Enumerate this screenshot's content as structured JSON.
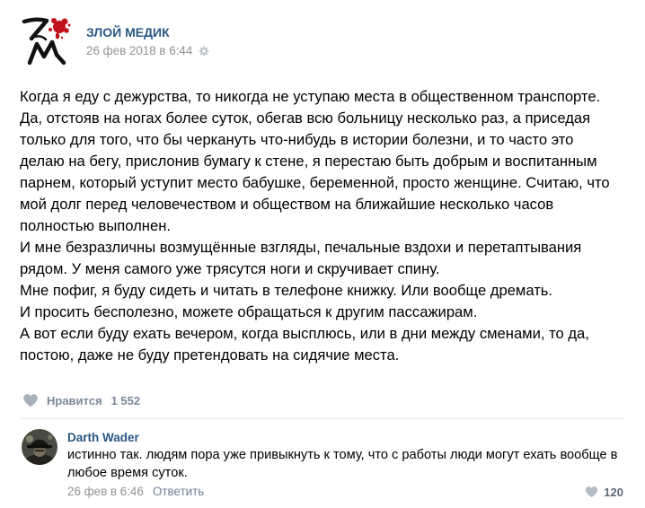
{
  "post": {
    "author": {
      "name": "ЗЛОЙ МЕДИК",
      "avatar_icon": "zm-logo-icon"
    },
    "date": "26 фев 2018 в 6:44",
    "settings_icon": "gear-icon",
    "lines": [
      "Когда я еду с дежурства, то никогда не уступаю места в общественном транспорте.",
      "Да, отстояв на ногах более суток, обегав всю больницу несколько раз, а приседая",
      "только для того, что бы черкануть что-нибудь в истории болезни, и то часто это",
      "делаю на бегу, прислонив бумагу к стене, я перестаю быть добрым и воспитанным",
      "парнем, который уступит место бабушке, беременной, просто женщине. Считаю, что",
      "мой долг перед человечеством и обществом на ближайшие несколько часов",
      "полностью выполнен.",
      "И мне безразличны возмущённые взгляды, печальные вздохи и перетаптывания",
      "рядом. У меня самого уже трясутся ноги и скручивает спину.",
      "Мне пофиг, я буду сидеть и читать в телефоне книжку. Или вообще дремать.",
      "И просить бесполезно, можете обращаться к другим пассажирам.",
      "А вот если буду ехать вечером, когда высплюсь, или в дни между сменами, то да,",
      "постою, даже не буду претендовать на сидячие места."
    ],
    "likes": {
      "icon": "heart-icon",
      "label": "Нравится",
      "count": "1 552"
    }
  },
  "comment": {
    "author": "Darth Wader",
    "avatar_icon": "commenter-avatar",
    "lines": [
      "истинно так. людям пора уже привыкнуть к тому, что с работы люди могут ехать вообще в",
      "любое время суток."
    ],
    "date": "26 фев в 6:46",
    "reply_label": "Ответить",
    "likes": {
      "icon": "heart-icon",
      "count": "120"
    }
  },
  "colors": {
    "link": "#2a5885",
    "meta": "#939393",
    "like": "#7a8899",
    "text": "#000000",
    "divider": "#e7e8ec",
    "logo_red": "#c0111b"
  }
}
